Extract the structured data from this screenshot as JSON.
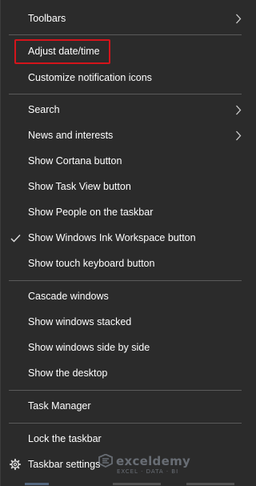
{
  "menu": {
    "items": [
      {
        "label": "Toolbars",
        "submenu": true
      },
      {
        "label": "Adjust date/time",
        "highlighted": true
      },
      {
        "label": "Customize notification icons"
      },
      {
        "label": "Search",
        "submenu": true
      },
      {
        "label": "News and interests",
        "submenu": true
      },
      {
        "label": "Show Cortana button"
      },
      {
        "label": "Show Task View button"
      },
      {
        "label": "Show People on the taskbar"
      },
      {
        "label": "Show Windows Ink Workspace button",
        "checked": true
      },
      {
        "label": "Show touch keyboard button"
      },
      {
        "label": "Cascade windows"
      },
      {
        "label": "Show windows stacked"
      },
      {
        "label": "Show windows side by side"
      },
      {
        "label": "Show the desktop"
      },
      {
        "label": "Task Manager"
      },
      {
        "label": "Lock the taskbar"
      },
      {
        "label": "Taskbar settings",
        "icon": "gear-icon"
      }
    ]
  },
  "watermark": {
    "name": "exceldemy",
    "tagline": "EXCEL · DATA · BI"
  },
  "colors": {
    "background": "#2b2b2b",
    "text": "#ffffff",
    "separator": "#5a5a5a",
    "highlight_border": "#d4141b"
  }
}
